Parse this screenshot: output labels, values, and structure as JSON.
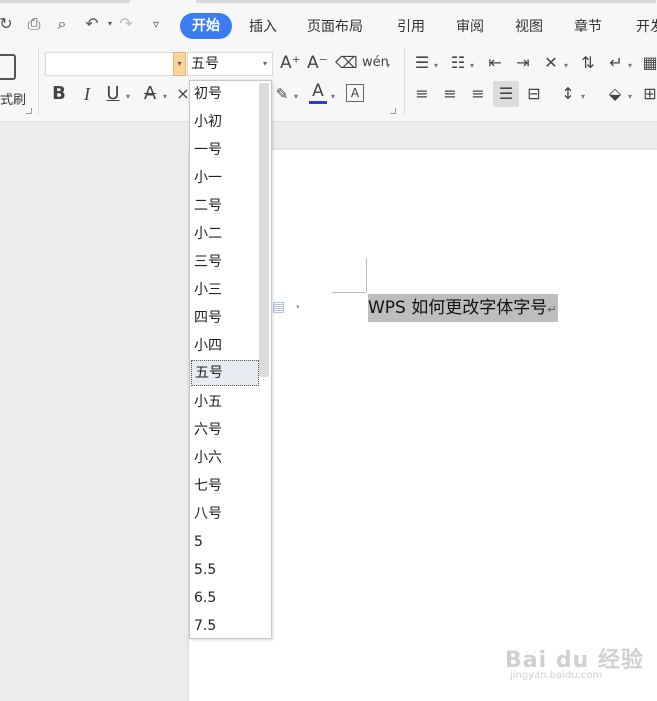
{
  "menu": {
    "items": [
      {
        "label": "开始",
        "active": true
      },
      {
        "label": "插入"
      },
      {
        "label": "页面布局"
      },
      {
        "label": "引用"
      },
      {
        "label": "审阅"
      },
      {
        "label": "视图"
      },
      {
        "label": "章节"
      },
      {
        "label": "开发"
      }
    ]
  },
  "ribbon": {
    "format_painter_label": "式刷",
    "font_name_value": "",
    "font_size_value": "五号"
  },
  "font_size_dropdown": {
    "selected": "五号",
    "options": [
      "初号",
      "小初",
      "一号",
      "小一",
      "二号",
      "小二",
      "三号",
      "小三",
      "四号",
      "小四",
      "五号",
      "小五",
      "六号",
      "小六",
      "七号",
      "八号",
      "5",
      "5.5",
      "6.5",
      "7.5"
    ]
  },
  "document": {
    "text": "WPS 如何更改字体字号",
    "paragraph_mark": "↵"
  },
  "watermark": {
    "brand": "Bai du 经验",
    "url": "jingyan.baidu.com"
  },
  "colors": {
    "accent": "#3d7cf0",
    "selection": "#bdbdbd",
    "font_color_underline": "#2b3fcf"
  }
}
